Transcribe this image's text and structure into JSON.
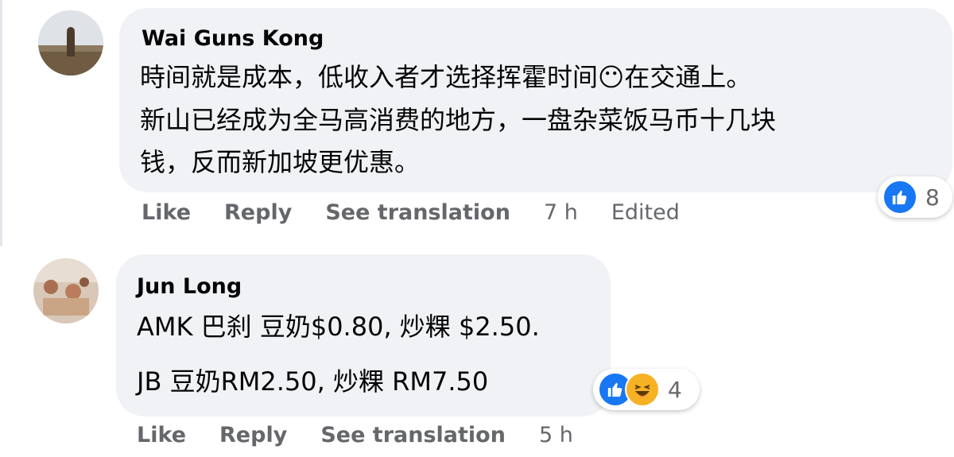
{
  "comments": [
    {
      "author": "Wai Guns Kong",
      "lines": [
        "時间就是成本，低收入者才选择挥霍时间😶在交通上。",
        "新山已经成为全马高消费的地方，一盘杂菜饭马币十几块",
        "钱，反而新加坡更优惠。"
      ],
      "actions": {
        "like": "Like",
        "reply": "Reply",
        "translate": "See translation",
        "time": "7 h",
        "edited": "Edited"
      },
      "reactions": {
        "types": [
          "like"
        ],
        "count": "8"
      }
    },
    {
      "author": "Jun Long",
      "lines": [
        "AMK 巴刹 豆奶$0.80, 炒粿 $2.50.",
        "JB 豆奶RM2.50, 炒粿 RM7.50"
      ],
      "actions": {
        "like": "Like",
        "reply": "Reply",
        "translate": "See translation",
        "time": "5 h"
      },
      "reactions": {
        "types": [
          "like",
          "haha"
        ],
        "count": "4"
      }
    }
  ],
  "colors": {
    "bubble": "#f0f2f5",
    "meta_text": "#65676b",
    "like_blue": "#1877f2",
    "haha_yellow": "#f7b125"
  }
}
